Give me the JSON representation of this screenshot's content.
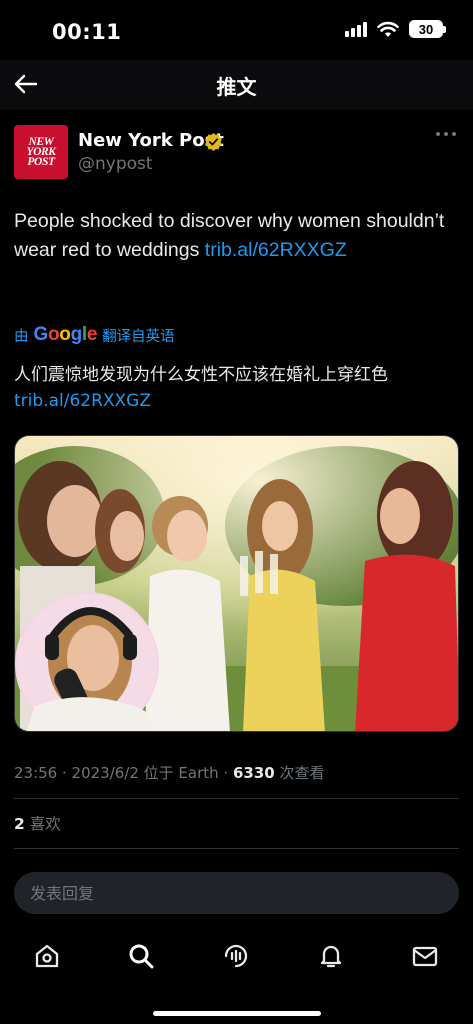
{
  "status_bar": {
    "time": "00:11",
    "battery": "30"
  },
  "nav": {
    "title": "推文"
  },
  "tweet": {
    "author_name": "New York Post",
    "author_handle": "@nypost",
    "avatar_text": [
      "NEW",
      "YORK",
      "POST"
    ],
    "text_plain": "People shocked to discover why women shouldn’t wear red to weddings ",
    "text_link": "trib.al/62RXXGZ",
    "translate": {
      "prefix": "由",
      "provider": "Google",
      "suffix": "翻译自英语"
    },
    "translated_plain": "人们震惊地发现为什么女性不应该在婚礼上穿红色",
    "translated_link": "trib.al/62RXXGZ",
    "meta": {
      "timestamp": "23:56 · 2023/6/2 位于 Earth · ",
      "views_count": "6330",
      "views_label": " 次查看"
    },
    "likes": {
      "count": "2",
      "label": " 喜欢"
    }
  },
  "reply": {
    "placeholder": "发表回复"
  },
  "tabs": [
    {
      "icon": "home-icon"
    },
    {
      "icon": "search-icon"
    },
    {
      "icon": "spaces-icon"
    },
    {
      "icon": "notifications-icon"
    },
    {
      "icon": "messages-icon"
    }
  ],
  "colors": {
    "link": "#1d9bf0",
    "verified_gold": "#e2b719",
    "nypost_red": "#c8102e",
    "background": "#000000"
  }
}
